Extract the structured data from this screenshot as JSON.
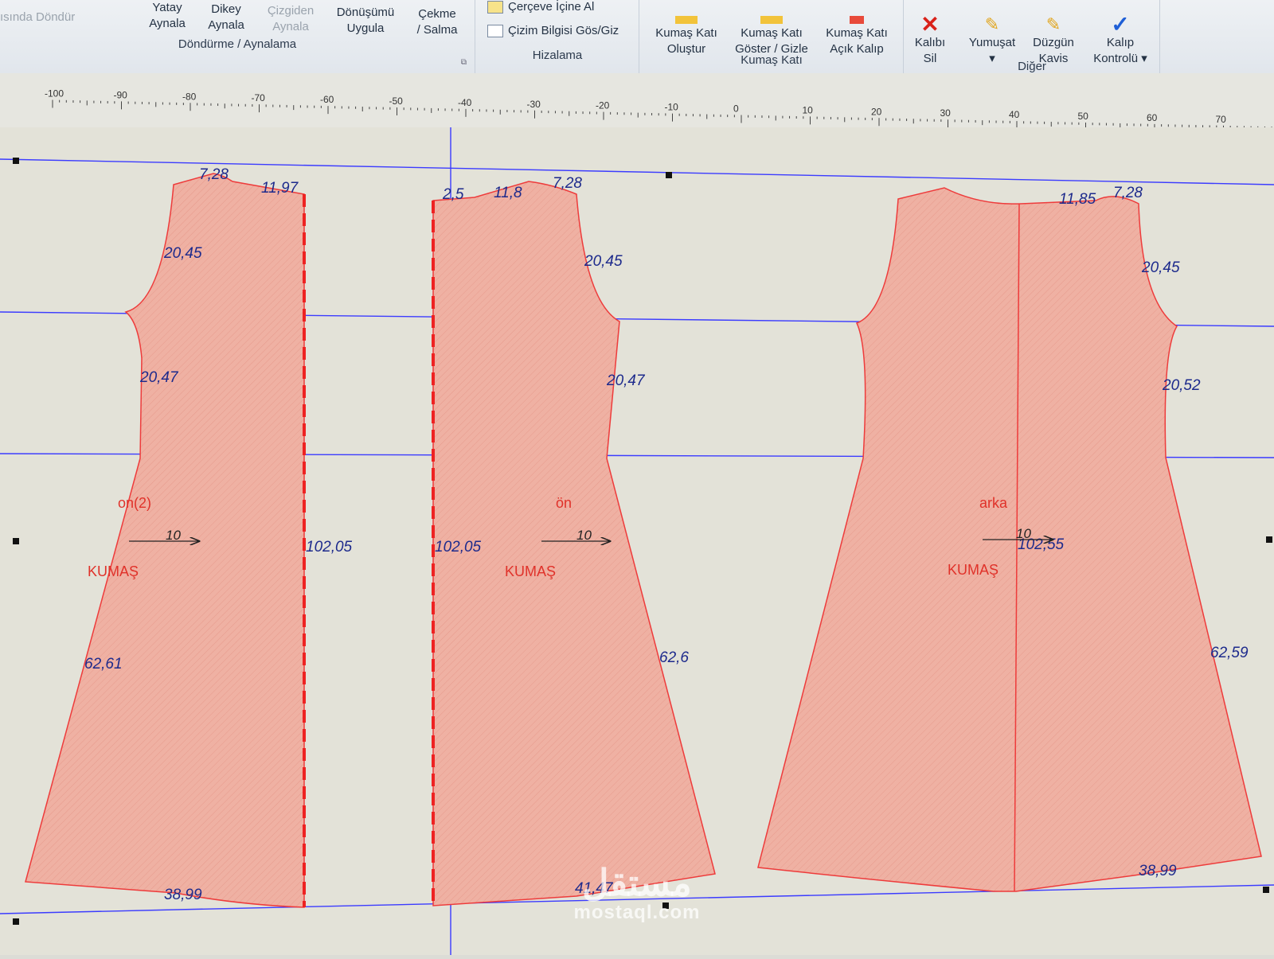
{
  "ribbon": {
    "dondurme": {
      "partial_label": "ısında Döndür",
      "yatay": "Yatay\nAynala",
      "dikey": "Dikey\nAynala",
      "cizgiden": "Çizgiden\nAynala",
      "donusumu": "Dönüşümü\nUygula",
      "cekme": "Çekme\n/ Salma",
      "title": "Döndürme / Aynalama"
    },
    "hizalama": {
      "cerceve": "Çerçeve İçine Al",
      "cizim": "Çizim Bilgisi Gös/Giz",
      "title": "Hizalama"
    },
    "kumas_kati": {
      "olustur": "Kumaş Katı\nOluştur",
      "goster": "Kumaş Katı\nGöster / Gizle",
      "acik": "Kumaş Katı\nAçık Kalıp",
      "title": "Kumaş Katı"
    },
    "diger": {
      "sil": "Kalıbı\nSil",
      "yumusat": "Yumuşat\n▾",
      "duzgun": "Düzgün\nKavis",
      "kontrol": "Kalıp\nKontrolü ▾",
      "title": "Diğer"
    }
  },
  "ruler": {
    "labels": [
      "-100",
      "-90",
      "-80",
      "-70",
      "-60",
      "-50",
      "-40",
      "-30",
      "-20",
      "-10",
      "0",
      "10",
      "20",
      "30",
      "40",
      "50",
      "60",
      "70"
    ]
  },
  "pieces": {
    "on2": {
      "name": "on(2)",
      "fabric": "KUMAŞ",
      "grain": "10",
      "shoulder_top": "7,28",
      "neck": "11,97",
      "armhole": "20,45",
      "side_upper": "20,47",
      "fold_length": "102,05",
      "side_lower": "62,61",
      "hem": "38,99"
    },
    "on": {
      "name": "ön",
      "fabric": "KUMAŞ",
      "grain": "10",
      "neck_small": "2,5",
      "neck": "11,8",
      "shoulder_top": "7,28",
      "armhole": "20,45",
      "side_upper": "20,47",
      "fold_length": "102,05",
      "side_lower": "62,6",
      "hem": "41,47"
    },
    "arka": {
      "name": "arka",
      "fabric": "KUMAŞ",
      "grain": "10",
      "neck": "11,85",
      "shoulder_top": "7,28",
      "armhole": "20,45",
      "side_upper": "20,52",
      "center_length": "102,55",
      "side_lower": "62,59",
      "hem": "38,99"
    }
  },
  "watermark": {
    "arabic": "مستقل",
    "latin": "mostaql.com"
  },
  "colors": {
    "piece_fill": "#efb1a3",
    "piece_outline": "#ee3b3b",
    "guide_line": "#3b3bff",
    "measure_text": "#1d2a8c",
    "label_red": "#e0322a"
  }
}
